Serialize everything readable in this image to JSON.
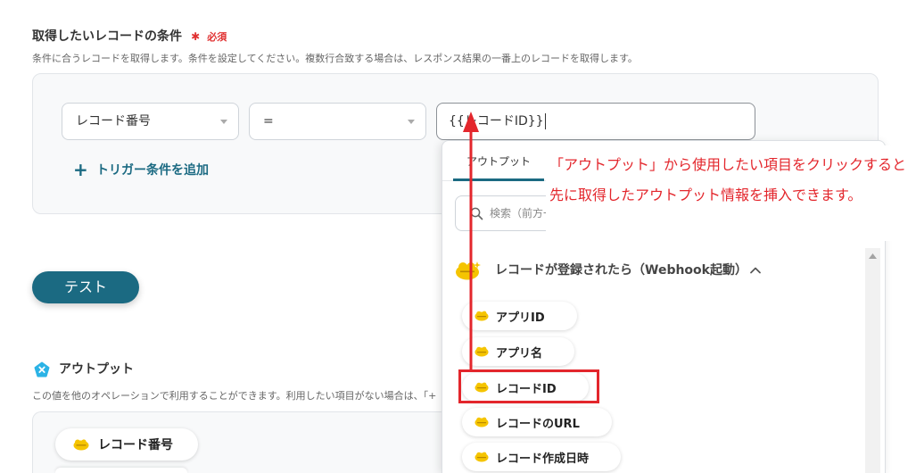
{
  "condition": {
    "title": "取得したいレコードの条件",
    "required_mark": "✱",
    "required_label": "必須",
    "description": "条件に合うレコードを取得します。条件を設定してください。複数行合致する場合は、レスポンス結果の一番上のレコードを取得します。",
    "field_select": {
      "value": "レコード番号",
      "icon": "chevron-down-icon"
    },
    "operator_select": {
      "value": "=",
      "icon": "chevron-down-icon"
    },
    "value_input": {
      "value": "{{レコードID}}"
    },
    "add_trigger": {
      "icon_glyph": "+",
      "label": "トリガー条件を追加"
    }
  },
  "test_button": {
    "label": "テスト"
  },
  "output": {
    "icon": "output-icon",
    "title": "アウトプット",
    "description": "この値を他のオペレーションで利用することができます。利用したい項目がない場合は、「+",
    "chips": [
      {
        "label": "レコード番号",
        "icon": "kintone-icon"
      }
    ]
  },
  "dropdown": {
    "tabs": [
      {
        "label": "アウトプット",
        "active": true
      }
    ],
    "search": {
      "placeholder": "検索（前方一",
      "icon": "search-icon"
    },
    "section": {
      "title": "レコードが登録されたら（Webhook起動）",
      "icon": "kintone-icon",
      "expanded": true,
      "toggle_icon": "chevron-up-icon",
      "items": [
        {
          "label": "アプリID",
          "icon": "kintone-icon"
        },
        {
          "label": "アプリ名",
          "icon": "kintone-icon"
        },
        {
          "label": "レコードID",
          "icon": "kintone-icon"
        },
        {
          "label": "レコードのURL",
          "icon": "kintone-icon"
        },
        {
          "label": "レコード作成日時",
          "icon": "kintone-icon"
        }
      ]
    },
    "scrollbar_icon": "scroll-up-arrow-icon"
  },
  "annotation": {
    "lines": [
      "「アウトプット」から使用したい項目をクリックすると",
      "先に取得したアウトプット情報を挿入できます。"
    ],
    "highlighted_item_index": 2,
    "arrow_icon": "arrow-up-icon"
  },
  "colors": {
    "accent": "#1b6a82",
    "required": "#e03131",
    "annotation": "#e3262c",
    "output_icon": "#2bb3e6",
    "kintone": "#f5c400"
  }
}
